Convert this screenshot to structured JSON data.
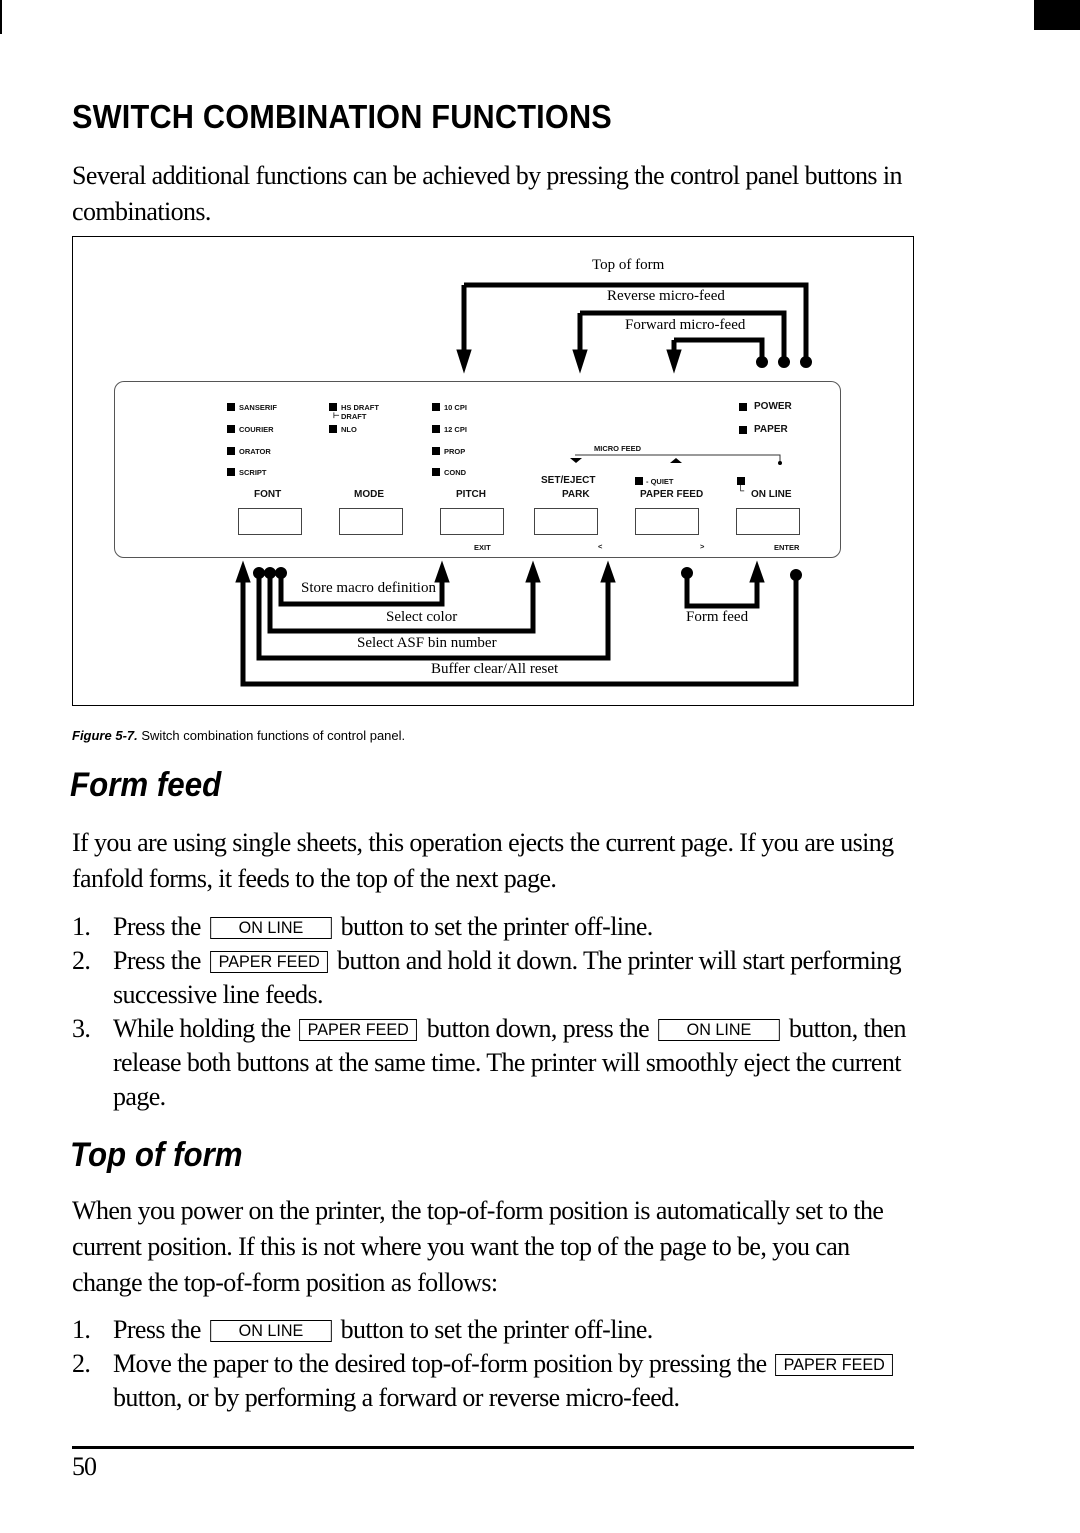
{
  "page": {
    "section_title": "SWITCH COMBINATION FUNCTIONS",
    "intro": "Several additional functions can be achieved by pressing the control panel buttons in combinations.",
    "page_number": "50"
  },
  "figure": {
    "caption_label": "Figure 5-7.",
    "caption_text": "Switch combination functions of control panel.",
    "top_labels": {
      "top_of_form": "Top of form",
      "reverse_micro_feed": "Reverse micro-feed",
      "forward_micro_feed": "Forward micro-feed"
    },
    "bottom_labels": {
      "store_macro": "Store macro definition",
      "select_color": "Select color",
      "select_asf": "Select ASF bin number",
      "buffer_clear": "Buffer clear/All reset",
      "form_feed": "Form feed"
    },
    "panel": {
      "font_leds": [
        "SANSERIF",
        "COURIER",
        "ORATOR",
        "SCRIPT"
      ],
      "mode_leds": [
        "HS DRAFT",
        "DRAFT",
        "NLO"
      ],
      "pitch_leds": [
        "10 CPI",
        "12 CPI",
        "PROP",
        "COND"
      ],
      "status_leds": [
        "POWER",
        "PAPER"
      ],
      "micro_feed": "MICRO FEED",
      "quiet": "- QUIET",
      "buttons": [
        {
          "label": "FONT",
          "sub": ""
        },
        {
          "label": "MODE",
          "sub": ""
        },
        {
          "label": "PITCH",
          "sub": "EXIT"
        },
        {
          "label": "SET/EJECT",
          "label2": "PARK",
          "sub": "<"
        },
        {
          "label": "PAPER FEED",
          "sub": ">"
        },
        {
          "label": "ON LINE",
          "sub": "ENTER"
        }
      ]
    }
  },
  "form_feed": {
    "title": "Form feed",
    "body": "If you are using single sheets, this operation ejects the current page. If you are using fanfold forms, it feeds to the top of the next page.",
    "steps": [
      {
        "num": "1.",
        "pre": "Press the",
        "key": "ON LINE",
        "post": "button to set the printer off-line."
      },
      {
        "num": "2.",
        "pre": "Press the",
        "key": "PAPER FEED",
        "post": "button and hold it down. The printer will start performing successive line feeds."
      },
      {
        "num": "3.",
        "pre": "While holding the",
        "key": "PAPER FEED",
        "mid": "button down, press the",
        "key2": "ON LINE",
        "post": "button, then release both buttons at the same time. The printer will smoothly eject the current page."
      }
    ]
  },
  "top_of_form": {
    "title": "Top of form",
    "body": "When you power on the printer, the top-of-form position is automatically set to the current position. If this is not where you want the top of the page to be, you can change the top-of-form position as follows:",
    "steps": [
      {
        "num": "1.",
        "pre": "Press the",
        "key": "ON LINE",
        "post": "button to set the printer off-line."
      },
      {
        "num": "2.",
        "pre": "Move the paper to the desired top-of-form position by pressing the",
        "key": "PAPER FEED",
        "post": "button, or by performing a forward or reverse micro-feed."
      }
    ]
  }
}
